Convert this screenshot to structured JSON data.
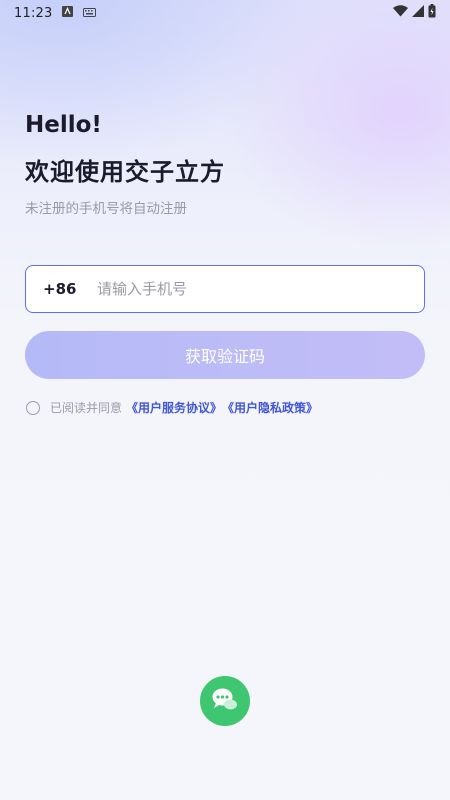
{
  "status_bar": {
    "time": "11:23"
  },
  "header": {
    "hello": "Hello!",
    "welcome": "欢迎使用交子立方",
    "subtitle": "未注册的手机号将自动注册"
  },
  "phone_form": {
    "country_code": "+86",
    "placeholder": "请输入手机号",
    "value": ""
  },
  "get_code_button": {
    "label": "获取验证码"
  },
  "agreement": {
    "prefix": "已阅读并同意",
    "user_agreement": "《用户服务协议》",
    "privacy_policy": "《用户隐私政策》",
    "checked": false
  },
  "colors": {
    "accent": "#4257d6",
    "input_border": "#6370e0",
    "button_gradient_start": "#b4baf7",
    "button_gradient_end": "#c3bdf7",
    "wechat_green": "#3ec671"
  },
  "icons": [
    "android-icon",
    "keyboard-icon",
    "wifi-icon",
    "signal-icon",
    "battery-icon",
    "wechat-icon"
  ]
}
